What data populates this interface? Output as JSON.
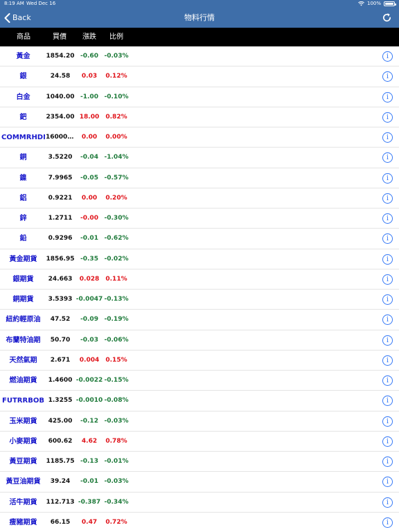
{
  "status_bar": {
    "time": "8:19 AM",
    "date": "Wed Dec 16",
    "battery": "100%"
  },
  "nav": {
    "back_label": "Back",
    "title": "物料行情"
  },
  "columns": {
    "name": "商品",
    "price": "買價",
    "change": "漲跌",
    "ratio": "比例"
  },
  "colors": {
    "nav_bg": "#3e6ea9",
    "header_bg": "#000000",
    "name_text": "#1a1acc",
    "up": "#e0141b",
    "down": "#1e7a3a",
    "info": "#3478f6"
  },
  "rows": [
    {
      "name": "黃金",
      "price": "1854.20",
      "change": "-0.60",
      "ratio": "-0.03%",
      "dir": "down"
    },
    {
      "name": "銀",
      "price": "24.58",
      "change": "0.03",
      "ratio": "0.12%",
      "dir": "up"
    },
    {
      "name": "白金",
      "price": "1040.00",
      "change": "-1.00",
      "ratio": "-0.10%",
      "dir": "down"
    },
    {
      "name": "鈀",
      "price": "2354.00",
      "change": "18.00",
      "ratio": "0.82%",
      "dir": "up"
    },
    {
      "name": "COMMRHDM",
      "price": "16000....",
      "change": "0.00",
      "ratio": "0.00%",
      "dir": "up"
    },
    {
      "name": "銅",
      "price": "3.5220",
      "change": "-0.04",
      "ratio": "-1.04%",
      "dir": "down"
    },
    {
      "name": "鎳",
      "price": "7.9965",
      "change": "-0.05",
      "ratio": "-0.57%",
      "dir": "down"
    },
    {
      "name": "鋁",
      "price": "0.9221",
      "change": "0.00",
      "ratio": "0.20%",
      "dir": "up"
    },
    {
      "name": "鋅",
      "price": "1.2711",
      "change": "-0.00",
      "ratio": "-0.30%",
      "dir": "mixed"
    },
    {
      "name": "鉛",
      "price": "0.9296",
      "change": "-0.01",
      "ratio": "-0.62%",
      "dir": "down"
    },
    {
      "name": "黃金期貨",
      "price": "1856.95",
      "change": "-0.35",
      "ratio": "-0.02%",
      "dir": "down"
    },
    {
      "name": "銀期貨",
      "price": "24.663",
      "change": "0.028",
      "ratio": "0.11%",
      "dir": "up"
    },
    {
      "name": "銅期貨",
      "price": "3.5393",
      "change": "-0.0047",
      "ratio": "-0.13%",
      "dir": "down"
    },
    {
      "name": "紐約輕原油",
      "price": "47.52",
      "change": "-0.09",
      "ratio": "-0.19%",
      "dir": "down"
    },
    {
      "name": "布蘭特油期",
      "price": "50.70",
      "change": "-0.03",
      "ratio": "-0.06%",
      "dir": "down"
    },
    {
      "name": "天然氣期",
      "price": "2.671",
      "change": "0.004",
      "ratio": "0.15%",
      "dir": "up"
    },
    {
      "name": "燃油期貨",
      "price": "1.4600",
      "change": "-0.0022",
      "ratio": "-0.15%",
      "dir": "down"
    },
    {
      "name": "FUTRRBOB",
      "price": "1.3255",
      "change": "-0.0010",
      "ratio": "-0.08%",
      "dir": "down"
    },
    {
      "name": "玉米期貨",
      "price": "425.00",
      "change": "-0.12",
      "ratio": "-0.03%",
      "dir": "down"
    },
    {
      "name": "小麥期貨",
      "price": "600.62",
      "change": "4.62",
      "ratio": "0.78%",
      "dir": "up"
    },
    {
      "name": "黃豆期貨",
      "price": "1185.75",
      "change": "-0.13",
      "ratio": "-0.01%",
      "dir": "down"
    },
    {
      "name": "黃豆油期貨",
      "price": "39.24",
      "change": "-0.01",
      "ratio": "-0.03%",
      "dir": "down"
    },
    {
      "name": "活牛期貨",
      "price": "112.713",
      "change": "-0.387",
      "ratio": "-0.34%",
      "dir": "down"
    },
    {
      "name": "瘦豬期貨",
      "price": "66.15",
      "change": "0.47",
      "ratio": "0.72%",
      "dir": "up"
    }
  ]
}
